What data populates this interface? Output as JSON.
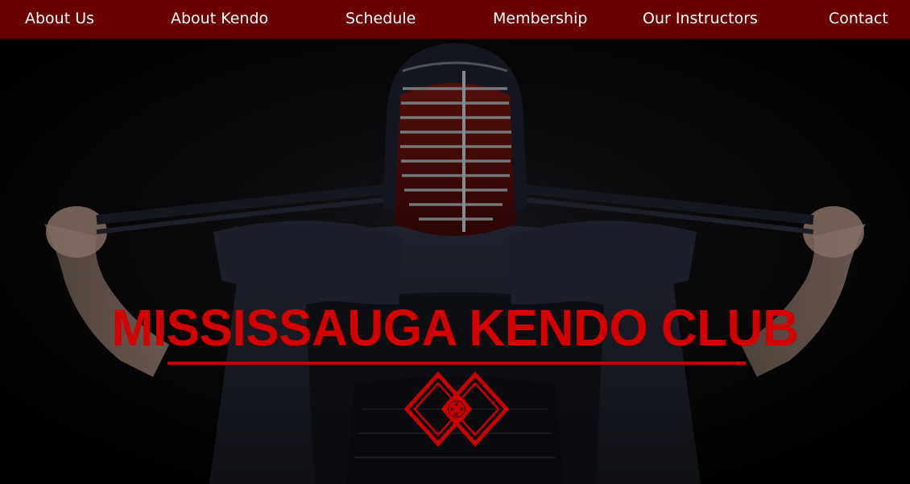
{
  "nav": {
    "items": [
      {
        "label": "About Us"
      },
      {
        "label": "About Kendo"
      },
      {
        "label": "Schedule"
      },
      {
        "label": "Membership"
      },
      {
        "label": "Our Instructors"
      },
      {
        "label": "Contact"
      }
    ]
  },
  "hero": {
    "title": "MISSISSAUGA KENDO CLUB",
    "image_subject": "kendo practitioner in bogu tying men-himo",
    "emblem_icon": "diamond-crest-icon"
  },
  "colors": {
    "nav_background": "#6b0000",
    "title_red": "#d40000",
    "background": "#050505",
    "nav_text": "#ffffff"
  }
}
